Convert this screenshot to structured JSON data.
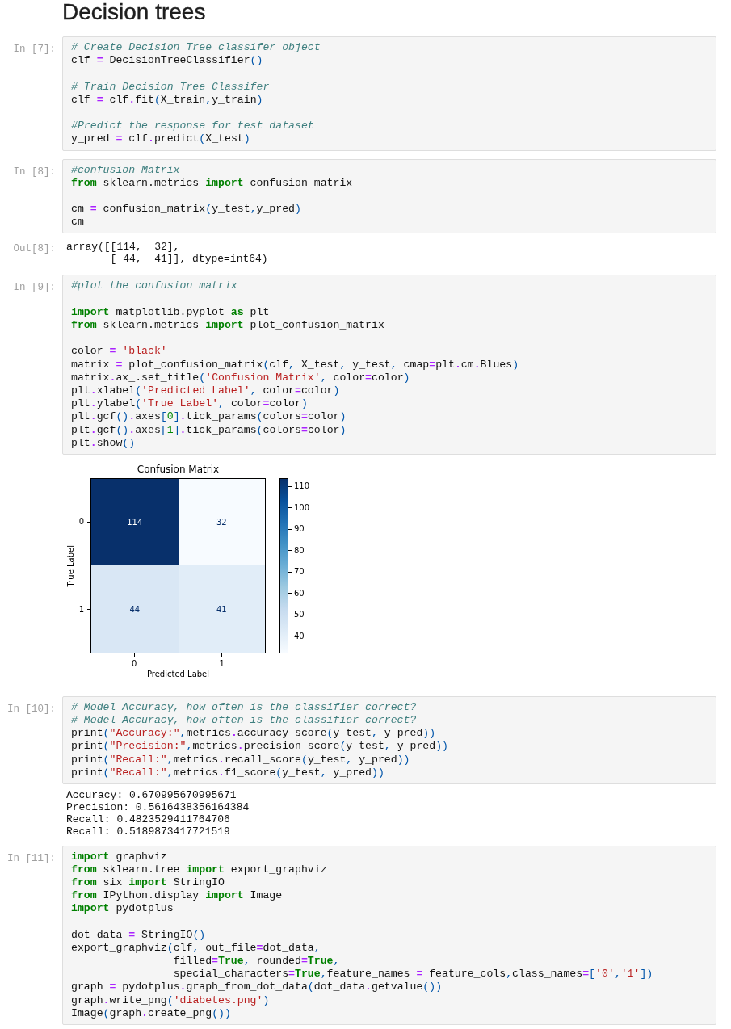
{
  "heading": "Decision trees",
  "cells": [
    {
      "input_prompt": "In [7]:",
      "code_blocks": [
        [
          [
            {
              "kind": "comment",
              "text": "# Create Decision Tree classifer object"
            }
          ],
          [
            {
              "kind": "text",
              "text": "clf "
            },
            {
              "kind": "operator",
              "text": "="
            },
            {
              "kind": "text",
              "text": " DecisionTreeClassifier"
            },
            {
              "kind": "bracket",
              "text": "()"
            }
          ]
        ],
        [
          [
            {
              "kind": "comment",
              "text": "# Train Decision Tree Classifer"
            }
          ],
          [
            {
              "kind": "text",
              "text": "clf "
            },
            {
              "kind": "operator",
              "text": "="
            },
            {
              "kind": "text",
              "text": " clf"
            },
            {
              "kind": "operator",
              "text": "."
            },
            {
              "kind": "text",
              "text": "fit"
            },
            {
              "kind": "bracket",
              "text": "("
            },
            {
              "kind": "text",
              "text": "X_train"
            },
            {
              "kind": "bracket",
              "text": ","
            },
            {
              "kind": "text",
              "text": "y_train"
            },
            {
              "kind": "bracket",
              "text": ")"
            }
          ]
        ],
        [
          [
            {
              "kind": "comment",
              "text": "#Predict the response for test dataset"
            }
          ],
          [
            {
              "kind": "text",
              "text": "y_pred "
            },
            {
              "kind": "operator",
              "text": "="
            },
            {
              "kind": "text",
              "text": " clf"
            },
            {
              "kind": "operator",
              "text": "."
            },
            {
              "kind": "text",
              "text": "predict"
            },
            {
              "kind": "bracket",
              "text": "("
            },
            {
              "kind": "text",
              "text": "X_test"
            },
            {
              "kind": "bracket",
              "text": ")"
            }
          ]
        ]
      ]
    },
    {
      "input_prompt": "In [8]:",
      "code_blocks": [
        [
          [
            {
              "kind": "comment",
              "text": "#confusion Matrix"
            }
          ],
          [
            {
              "kind": "keyword",
              "text": "from"
            },
            {
              "kind": "text",
              "text": " sklearn.metrics "
            },
            {
              "kind": "keyword",
              "text": "import"
            },
            {
              "kind": "text",
              "text": " confusion_matrix"
            }
          ]
        ],
        [
          [
            {
              "kind": "text",
              "text": "cm "
            },
            {
              "kind": "operator",
              "text": "="
            },
            {
              "kind": "text",
              "text": " confusion_matrix"
            },
            {
              "kind": "bracket",
              "text": "("
            },
            {
              "kind": "text",
              "text": "y_test"
            },
            {
              "kind": "bracket",
              "text": ","
            },
            {
              "kind": "text",
              "text": "y_pred"
            },
            {
              "kind": "bracket",
              "text": ")"
            }
          ],
          [
            {
              "kind": "text",
              "text": "cm"
            }
          ]
        ]
      ],
      "outputs": [
        {
          "kind": "result",
          "prompt": "Out[8]:",
          "lines": [
            "array([[114,  32],",
            "       [ 44,  41]], dtype=int64)"
          ]
        }
      ]
    },
    {
      "input_prompt": "In [9]:",
      "code_blocks": [
        [
          [
            {
              "kind": "comment",
              "text": "#plot the confusion matrix"
            }
          ]
        ],
        [
          [
            {
              "kind": "keyword",
              "text": "import"
            },
            {
              "kind": "text",
              "text": " matplotlib.pyplot "
            },
            {
              "kind": "keyword",
              "text": "as"
            },
            {
              "kind": "text",
              "text": " plt"
            }
          ],
          [
            {
              "kind": "keyword",
              "text": "from"
            },
            {
              "kind": "text",
              "text": " sklearn.metrics "
            },
            {
              "kind": "keyword",
              "text": "import"
            },
            {
              "kind": "text",
              "text": " plot_confusion_matrix"
            }
          ]
        ],
        [
          [
            {
              "kind": "text",
              "text": "color "
            },
            {
              "kind": "operator",
              "text": "= "
            },
            {
              "kind": "string",
              "text": "'black'"
            }
          ],
          [
            {
              "kind": "text",
              "text": "matrix "
            },
            {
              "kind": "operator",
              "text": "="
            },
            {
              "kind": "text",
              "text": " plot_confusion_matrix"
            },
            {
              "kind": "bracket",
              "text": "("
            },
            {
              "kind": "text",
              "text": "clf"
            },
            {
              "kind": "bracket",
              "text": ","
            },
            {
              "kind": "text",
              "text": " X_test"
            },
            {
              "kind": "bracket",
              "text": ","
            },
            {
              "kind": "text",
              "text": " y_test"
            },
            {
              "kind": "bracket",
              "text": ","
            },
            {
              "kind": "text",
              "text": " cmap"
            },
            {
              "kind": "operator",
              "text": "="
            },
            {
              "kind": "text",
              "text": "plt"
            },
            {
              "kind": "operator",
              "text": "."
            },
            {
              "kind": "text",
              "text": "cm"
            },
            {
              "kind": "operator",
              "text": "."
            },
            {
              "kind": "text",
              "text": "Blues"
            },
            {
              "kind": "bracket",
              "text": ")"
            }
          ],
          [
            {
              "kind": "text",
              "text": "matrix"
            },
            {
              "kind": "operator",
              "text": "."
            },
            {
              "kind": "text",
              "text": "ax_.set_title"
            },
            {
              "kind": "bracket",
              "text": "("
            },
            {
              "kind": "string",
              "text": "'Confusion Matrix'"
            },
            {
              "kind": "bracket",
              "text": ","
            },
            {
              "kind": "text",
              "text": " color"
            },
            {
              "kind": "operator",
              "text": "="
            },
            {
              "kind": "text",
              "text": "color"
            },
            {
              "kind": "bracket",
              "text": ")"
            }
          ],
          [
            {
              "kind": "text",
              "text": "plt"
            },
            {
              "kind": "operator",
              "text": "."
            },
            {
              "kind": "text",
              "text": "xlabel"
            },
            {
              "kind": "bracket",
              "text": "("
            },
            {
              "kind": "string",
              "text": "'Predicted Label'"
            },
            {
              "kind": "bracket",
              "text": ","
            },
            {
              "kind": "text",
              "text": " color"
            },
            {
              "kind": "operator",
              "text": "="
            },
            {
              "kind": "text",
              "text": "color"
            },
            {
              "kind": "bracket",
              "text": ")"
            }
          ],
          [
            {
              "kind": "text",
              "text": "plt"
            },
            {
              "kind": "operator",
              "text": "."
            },
            {
              "kind": "text",
              "text": "ylabel"
            },
            {
              "kind": "bracket",
              "text": "("
            },
            {
              "kind": "string",
              "text": "'True Label'"
            },
            {
              "kind": "bracket",
              "text": ","
            },
            {
              "kind": "text",
              "text": " color"
            },
            {
              "kind": "operator",
              "text": "="
            },
            {
              "kind": "text",
              "text": "color"
            },
            {
              "kind": "bracket",
              "text": ")"
            }
          ],
          [
            {
              "kind": "text",
              "text": "plt"
            },
            {
              "kind": "operator",
              "text": "."
            },
            {
              "kind": "text",
              "text": "gcf"
            },
            {
              "kind": "bracket",
              "text": "()"
            },
            {
              "kind": "operator",
              "text": "."
            },
            {
              "kind": "text",
              "text": "axes"
            },
            {
              "kind": "bracket",
              "text": "["
            },
            {
              "kind": "number",
              "text": "0"
            },
            {
              "kind": "bracket",
              "text": "]"
            },
            {
              "kind": "operator",
              "text": "."
            },
            {
              "kind": "text",
              "text": "tick_params"
            },
            {
              "kind": "bracket",
              "text": "("
            },
            {
              "kind": "text",
              "text": "colors"
            },
            {
              "kind": "operator",
              "text": "="
            },
            {
              "kind": "text",
              "text": "color"
            },
            {
              "kind": "bracket",
              "text": ")"
            }
          ],
          [
            {
              "kind": "text",
              "text": "plt"
            },
            {
              "kind": "operator",
              "text": "."
            },
            {
              "kind": "text",
              "text": "gcf"
            },
            {
              "kind": "bracket",
              "text": "()"
            },
            {
              "kind": "operator",
              "text": "."
            },
            {
              "kind": "text",
              "text": "axes"
            },
            {
              "kind": "bracket",
              "text": "["
            },
            {
              "kind": "number",
              "text": "1"
            },
            {
              "kind": "bracket",
              "text": "]"
            },
            {
              "kind": "operator",
              "text": "."
            },
            {
              "kind": "text",
              "text": "tick_params"
            },
            {
              "kind": "bracket",
              "text": "("
            },
            {
              "kind": "text",
              "text": "colors"
            },
            {
              "kind": "operator",
              "text": "="
            },
            {
              "kind": "text",
              "text": "color"
            },
            {
              "kind": "bracket",
              "text": ")"
            }
          ],
          [
            {
              "kind": "text",
              "text": "plt"
            },
            {
              "kind": "operator",
              "text": "."
            },
            {
              "kind": "text",
              "text": "show"
            },
            {
              "kind": "bracket",
              "text": "()"
            }
          ]
        ]
      ],
      "outputs": [
        {
          "kind": "figure",
          "title": "Confusion Matrix",
          "xlabel": "Predicted Label",
          "ylabel": "True Label",
          "xticks": [
            "0",
            "1"
          ],
          "yticks": [
            "0",
            "1"
          ],
          "matrix": [
            [
              {
                "text": "114",
                "color": "#08306b"
              },
              {
                "text": "32",
                "color": "#f7fbff"
              }
            ],
            [
              {
                "text": "44",
                "color": "#d9e7f5"
              },
              {
                "text": "41",
                "color": "#e1edf8"
              }
            ]
          ],
          "colorbar_ticks": [
            "110",
            "100",
            "90",
            "80",
            "70",
            "60",
            "50",
            "40"
          ]
        }
      ]
    },
    {
      "input_prompt": "In [10]:",
      "code_blocks": [
        [
          [
            {
              "kind": "comment",
              "text": "# Model Accuracy, how often is the classifier correct?"
            }
          ],
          [
            {
              "kind": "comment",
              "text": "# Model Accuracy, how often is the classifier correct?"
            }
          ],
          [
            {
              "kind": "text",
              "text": "print"
            },
            {
              "kind": "bracket",
              "text": "("
            },
            {
              "kind": "string",
              "text": "\"Accuracy:\""
            },
            {
              "kind": "bracket",
              "text": ","
            },
            {
              "kind": "text",
              "text": "metrics"
            },
            {
              "kind": "operator",
              "text": "."
            },
            {
              "kind": "text",
              "text": "accuracy_score"
            },
            {
              "kind": "bracket",
              "text": "("
            },
            {
              "kind": "text",
              "text": "y_test"
            },
            {
              "kind": "bracket",
              "text": ","
            },
            {
              "kind": "text",
              "text": " y_pred"
            },
            {
              "kind": "bracket",
              "text": "))"
            }
          ],
          [
            {
              "kind": "text",
              "text": "print"
            },
            {
              "kind": "bracket",
              "text": "("
            },
            {
              "kind": "string",
              "text": "\"Precision:\""
            },
            {
              "kind": "bracket",
              "text": ","
            },
            {
              "kind": "text",
              "text": "metrics"
            },
            {
              "kind": "operator",
              "text": "."
            },
            {
              "kind": "text",
              "text": "precision_score"
            },
            {
              "kind": "bracket",
              "text": "("
            },
            {
              "kind": "text",
              "text": "y_test"
            },
            {
              "kind": "bracket",
              "text": ","
            },
            {
              "kind": "text",
              "text": " y_pred"
            },
            {
              "kind": "bracket",
              "text": "))"
            }
          ],
          [
            {
              "kind": "text",
              "text": "print"
            },
            {
              "kind": "bracket",
              "text": "("
            },
            {
              "kind": "string",
              "text": "\"Recall:\""
            },
            {
              "kind": "bracket",
              "text": ","
            },
            {
              "kind": "text",
              "text": "metrics"
            },
            {
              "kind": "operator",
              "text": "."
            },
            {
              "kind": "text",
              "text": "recall_score"
            },
            {
              "kind": "bracket",
              "text": "("
            },
            {
              "kind": "text",
              "text": "y_test"
            },
            {
              "kind": "bracket",
              "text": ","
            },
            {
              "kind": "text",
              "text": " y_pred"
            },
            {
              "kind": "bracket",
              "text": "))"
            }
          ],
          [
            {
              "kind": "text",
              "text": "print"
            },
            {
              "kind": "bracket",
              "text": "("
            },
            {
              "kind": "string",
              "text": "\"Recall:\""
            },
            {
              "kind": "bracket",
              "text": ","
            },
            {
              "kind": "text",
              "text": "metrics"
            },
            {
              "kind": "operator",
              "text": "."
            },
            {
              "kind": "text",
              "text": "f1_score"
            },
            {
              "kind": "bracket",
              "text": "("
            },
            {
              "kind": "text",
              "text": "y_test"
            },
            {
              "kind": "bracket",
              "text": ","
            },
            {
              "kind": "text",
              "text": " y_pred"
            },
            {
              "kind": "bracket",
              "text": "))"
            }
          ]
        ]
      ],
      "outputs": [
        {
          "kind": "stream",
          "lines": [
            "Accuracy: 0.670995670995671",
            "Precision: 0.5616438356164384",
            "Recall: 0.4823529411764706",
            "Recall: 0.5189873417721519"
          ]
        }
      ]
    },
    {
      "input_prompt": "In [11]:",
      "code_blocks": [
        [
          [
            {
              "kind": "keyword",
              "text": "import"
            },
            {
              "kind": "text",
              "text": " graphviz"
            }
          ],
          [
            {
              "kind": "keyword",
              "text": "from"
            },
            {
              "kind": "text",
              "text": " sklearn.tree "
            },
            {
              "kind": "keyword",
              "text": "import"
            },
            {
              "kind": "text",
              "text": " export_graphviz"
            }
          ],
          [
            {
              "kind": "keyword",
              "text": "from"
            },
            {
              "kind": "text",
              "text": " six "
            },
            {
              "kind": "keyword",
              "text": "import"
            },
            {
              "kind": "text",
              "text": " StringIO"
            }
          ],
          [
            {
              "kind": "keyword",
              "text": "from"
            },
            {
              "kind": "text",
              "text": " IPython.display "
            },
            {
              "kind": "keyword",
              "text": "import"
            },
            {
              "kind": "text",
              "text": " Image"
            }
          ],
          [
            {
              "kind": "keyword",
              "text": "import"
            },
            {
              "kind": "text",
              "text": " pydotplus"
            }
          ]
        ],
        [
          [
            {
              "kind": "text",
              "text": "dot_data "
            },
            {
              "kind": "operator",
              "text": "="
            },
            {
              "kind": "text",
              "text": " StringIO"
            },
            {
              "kind": "bracket",
              "text": "()"
            }
          ],
          [
            {
              "kind": "text",
              "text": "export_graphviz"
            },
            {
              "kind": "bracket",
              "text": "("
            },
            {
              "kind": "text",
              "text": "clf"
            },
            {
              "kind": "bracket",
              "text": ","
            },
            {
              "kind": "text",
              "text": " out_file"
            },
            {
              "kind": "operator",
              "text": "="
            },
            {
              "kind": "text",
              "text": "dot_data"
            },
            {
              "kind": "bracket",
              "text": ","
            }
          ],
          [
            {
              "kind": "text",
              "text": "                filled"
            },
            {
              "kind": "operator",
              "text": "="
            },
            {
              "kind": "keyword",
              "text": "True"
            },
            {
              "kind": "bracket",
              "text": ","
            },
            {
              "kind": "text",
              "text": " rounded"
            },
            {
              "kind": "operator",
              "text": "="
            },
            {
              "kind": "keyword",
              "text": "True"
            },
            {
              "kind": "bracket",
              "text": ","
            }
          ],
          [
            {
              "kind": "text",
              "text": "                special_characters"
            },
            {
              "kind": "operator",
              "text": "="
            },
            {
              "kind": "keyword",
              "text": "True"
            },
            {
              "kind": "bracket",
              "text": ","
            },
            {
              "kind": "text",
              "text": "feature_names "
            },
            {
              "kind": "operator",
              "text": "="
            },
            {
              "kind": "text",
              "text": " feature_cols"
            },
            {
              "kind": "bracket",
              "text": ","
            },
            {
              "kind": "text",
              "text": "class_names"
            },
            {
              "kind": "operator",
              "text": "="
            },
            {
              "kind": "bracket",
              "text": "["
            },
            {
              "kind": "string",
              "text": "'0'"
            },
            {
              "kind": "bracket",
              "text": ","
            },
            {
              "kind": "string",
              "text": "'1'"
            },
            {
              "kind": "bracket",
              "text": "])"
            }
          ],
          [
            {
              "kind": "text",
              "text": "graph "
            },
            {
              "kind": "operator",
              "text": "="
            },
            {
              "kind": "text",
              "text": " pydotplus"
            },
            {
              "kind": "operator",
              "text": "."
            },
            {
              "kind": "text",
              "text": "graph_from_dot_data"
            },
            {
              "kind": "bracket",
              "text": "("
            },
            {
              "kind": "text",
              "text": "dot_data"
            },
            {
              "kind": "operator",
              "text": "."
            },
            {
              "kind": "text",
              "text": "getvalue"
            },
            {
              "kind": "bracket",
              "text": "())"
            }
          ],
          [
            {
              "kind": "text",
              "text": "graph"
            },
            {
              "kind": "operator",
              "text": "."
            },
            {
              "kind": "text",
              "text": "write_png"
            },
            {
              "kind": "bracket",
              "text": "("
            },
            {
              "kind": "string",
              "text": "'diabetes.png'"
            },
            {
              "kind": "bracket",
              "text": ")"
            }
          ],
          [
            {
              "kind": "text",
              "text": "Image"
            },
            {
              "kind": "bracket",
              "text": "("
            },
            {
              "kind": "text",
              "text": "graph"
            },
            {
              "kind": "operator",
              "text": "."
            },
            {
              "kind": "text",
              "text": "create_png"
            },
            {
              "kind": "bracket",
              "text": "())"
            }
          ]
        ]
      ]
    }
  ]
}
